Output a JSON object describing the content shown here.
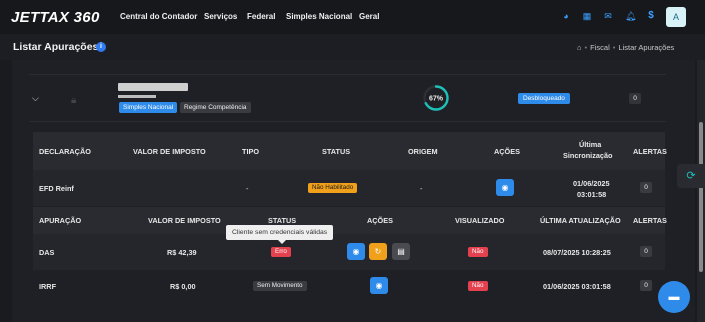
{
  "brand": {
    "logo": "JETTAX 360"
  },
  "nav": [
    "Central do Contador",
    "Serviços",
    "Federal",
    "Simples Nacional",
    "Geral"
  ],
  "top_icons": [
    "palette-icon",
    "grid-icon",
    "mail-icon",
    "bell-icon",
    "dollar-icon"
  ],
  "user": {
    "avatar_letter": "A"
  },
  "page": {
    "title": "Listar Apurações",
    "breadcrumb": [
      "Fiscal",
      "Listar Apurações"
    ]
  },
  "company": {
    "badges": [
      "Simples Nacional",
      "Regime Competência"
    ],
    "progress": {
      "label": "67%",
      "value": 0.67
    },
    "status": "Desbloqueado",
    "alerts": "0"
  },
  "declaracoes": {
    "headers": [
      "DECLARAÇÃO",
      "VALOR DE IMPOSTO",
      "TIPO",
      "STATUS",
      "ORIGEM",
      "AÇÕES",
      "Última",
      "Sincronização",
      "ALERTAS"
    ],
    "row": {
      "name": "EFD Reinf",
      "tipo": "-",
      "status": "Não Habilitado",
      "origem": "-",
      "sync_date": "01/06/2025",
      "sync_time": "03:01:58",
      "alerts": "0"
    }
  },
  "apuracoes": {
    "headers": [
      "APURAÇÃO",
      "VALOR DE IMPOSTO",
      "STATUS",
      "AÇÕES",
      "VISUALIZADO",
      "ÚLTIMA ATUALIZAÇÃO",
      "ALERTAS"
    ],
    "rows": [
      {
        "name": "DAS",
        "valor": "R$ 42,39",
        "status": "Erro",
        "visualizado": "Não",
        "atualizacao": "08/07/2025 10:28:25",
        "alerts": "0"
      },
      {
        "name": "IRRF",
        "valor": "R$ 0,00",
        "status": "Sem Movimento",
        "visualizado": "Não",
        "atualizacao": "01/06/2025 03:01:58",
        "alerts": "0"
      }
    ]
  },
  "tooltip": "Cliente sem credenciais válidas",
  "colors": {
    "accent": "#2f8bea",
    "warning": "#f0a01a",
    "danger": "#e4414f",
    "teal": "#1fbfb8",
    "background": "#1a1b1f"
  }
}
